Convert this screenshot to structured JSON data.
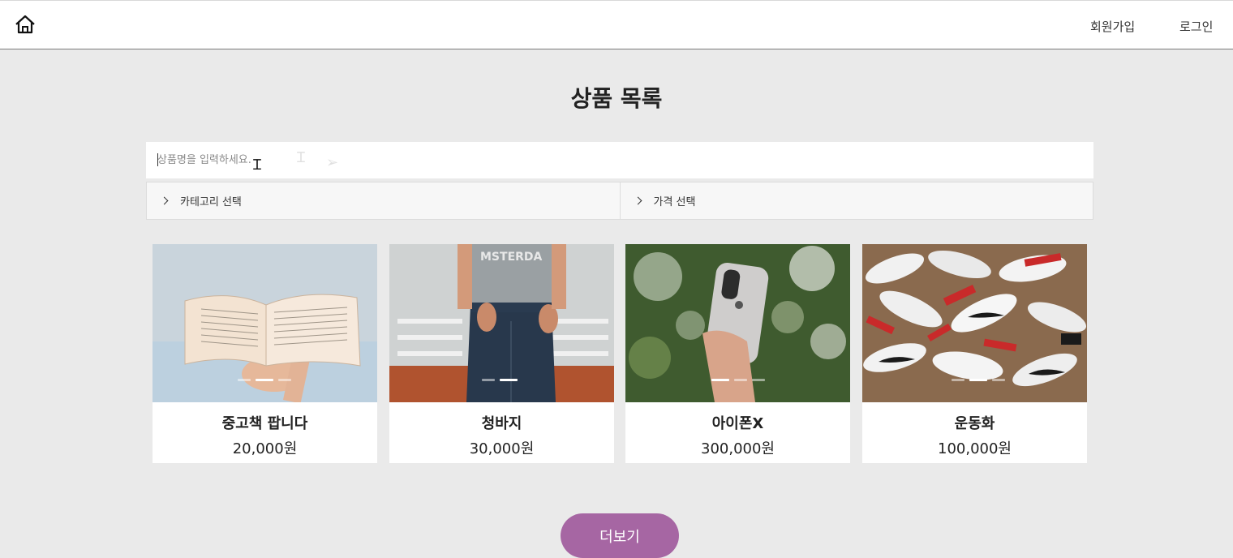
{
  "header": {
    "home_icon": "home-icon",
    "signup_label": "회원가입",
    "login_label": "로그인"
  },
  "main": {
    "title": "상품 목록",
    "search": {
      "placeholder": "상품명을 입력하세요.",
      "value": ""
    },
    "filters": [
      {
        "label": "카테고리 선택",
        "icon": "chevron-right-icon"
      },
      {
        "label": "가격 선택",
        "icon": "chevron-right-icon"
      }
    ],
    "products": [
      {
        "name": "중고책 팝니다",
        "price": "20,000원",
        "image": "open-book-photo",
        "slides": 3,
        "active_slide": 2
      },
      {
        "name": "청바지",
        "price": "30,000원",
        "image": "jeans-photo",
        "slides": 2,
        "active_slide": 2
      },
      {
        "name": "아이폰X",
        "price": "300,000원",
        "image": "iphone-photo",
        "slides": 3,
        "active_slide": 1
      },
      {
        "name": "운동화",
        "price": "100,000원",
        "image": "sneakers-photo",
        "slides": 3,
        "active_slide": 2
      }
    ],
    "more_label": "더보기"
  },
  "colors": {
    "background": "#eaeaea",
    "accent": "#a666a3",
    "card": "#ffffff"
  }
}
